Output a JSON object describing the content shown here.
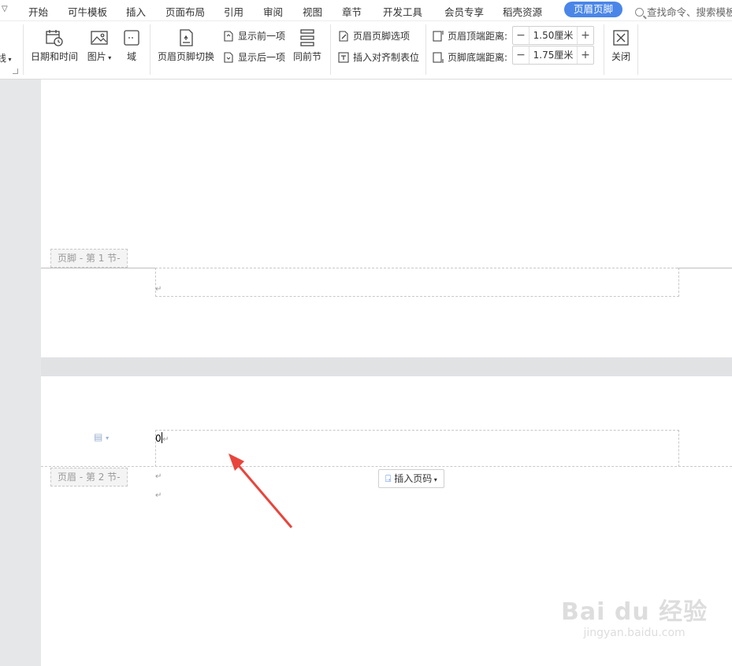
{
  "menubar": {
    "tabs": [
      {
        "label": "开始"
      },
      {
        "label": "可牛模板"
      },
      {
        "label": "插入"
      },
      {
        "label": "页面布局"
      },
      {
        "label": "引用"
      },
      {
        "label": "审阅"
      },
      {
        "label": "视图"
      },
      {
        "label": "章节"
      },
      {
        "label": "开发工具"
      },
      {
        "label": "会员专享"
      },
      {
        "label": "稻壳资源"
      }
    ],
    "active_tab": "页眉页脚",
    "search_text": "查找命令、搜索模板"
  },
  "ribbon": {
    "cut_label": "线",
    "date_time": "日期和时间",
    "picture": "图片",
    "field": "域",
    "switch": "页眉页脚切换",
    "show_prev": "显示前一项",
    "show_next": "显示后一项",
    "same_as_prev": "同前节",
    "options": "页眉页脚选项",
    "insert_tab": "插入对齐制表位",
    "header_top_label": "页眉顶端距离:",
    "header_top_value": "1.50厘米",
    "footer_bottom_label": "页脚底端距离:",
    "footer_bottom_value": "1.75厘米",
    "minus": "−",
    "plus": "+",
    "close": "关闭"
  },
  "document": {
    "footer_label_1": "页脚 - 第 1 节-",
    "header_label_2": "页眉 - 第 2 节-",
    "header_text": "0",
    "para_mark": "↵",
    "insert_page_number": "插入页码"
  },
  "watermark": {
    "big": "Bai du 经验",
    "small": "jingyan.baidu.com"
  },
  "colors": {
    "accent": "#4a86e8",
    "arrow": "#e8453c"
  }
}
